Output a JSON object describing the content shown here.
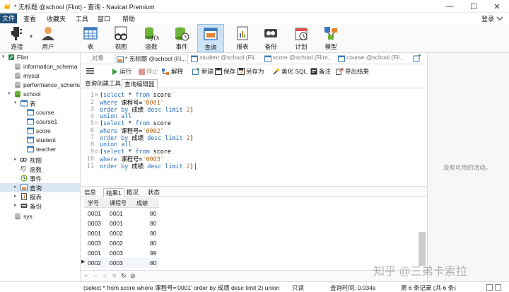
{
  "window": {
    "title": "* 无标题 @school (Flint) - 查询 - Navicat Premium",
    "login_label": "登录",
    "minimize_glyph": "—",
    "maximize_glyph": "☐",
    "close_glyph": "✕"
  },
  "menu": [
    "文件",
    "查看",
    "收藏夹",
    "工具",
    "窗口",
    "帮助"
  ],
  "toolbar": [
    {
      "label": "连接",
      "icon": "connection-icon"
    },
    {
      "label": "用户",
      "icon": "user-icon"
    },
    {
      "label": "表",
      "icon": "table-icon"
    },
    {
      "label": "视图",
      "icon": "view-icon"
    },
    {
      "label": "函数",
      "icon": "function-icon"
    },
    {
      "label": "事件",
      "icon": "event-icon"
    },
    {
      "label": "查询",
      "icon": "query-icon"
    },
    {
      "label": "报表",
      "icon": "report-icon"
    },
    {
      "label": "备份",
      "icon": "backup-icon"
    },
    {
      "label": "计划",
      "icon": "schedule-icon"
    },
    {
      "label": "模型",
      "icon": "model-icon"
    }
  ],
  "sidebar": {
    "items": [
      {
        "label": "Flint"
      },
      {
        "label": "information_schema"
      },
      {
        "label": "mysql"
      },
      {
        "label": "performance_schema"
      },
      {
        "label": "school"
      },
      {
        "label": "表"
      },
      {
        "label": "course"
      },
      {
        "label": "course1"
      },
      {
        "label": "score"
      },
      {
        "label": "student"
      },
      {
        "label": "teacher"
      },
      {
        "label": "视图"
      },
      {
        "label": "函数"
      },
      {
        "label": "事件"
      },
      {
        "label": "查询"
      },
      {
        "label": "报表"
      },
      {
        "label": "备份"
      },
      {
        "label": "sys"
      }
    ]
  },
  "tabs": [
    {
      "label": "对象"
    },
    {
      "label": "* 无标题 @school (Fl..."
    },
    {
      "label": "student @school (Fli..."
    },
    {
      "label": "score @school (Flint..."
    },
    {
      "label": "course @school (Fli..."
    }
  ],
  "query_toolbar": {
    "run": "运行",
    "stop": "停止",
    "explain": "解释",
    "new": "新建",
    "save": "保存",
    "save_as": "另存为",
    "beautify": "美化 SQL",
    "comment": "备注",
    "export": "导出结果"
  },
  "subtabs": [
    "查询创建工具",
    "查询编辑器"
  ],
  "code": [
    [
      "(select * from score"
    ],
    [
      "where 课程号='0001'"
    ],
    [
      "order by 成绩 desc limit 2)"
    ],
    [
      "union all"
    ],
    [
      "(select * from score"
    ],
    [
      "where 课程号='0002'"
    ],
    [
      "order by 成绩 desc limit 2)"
    ],
    [
      "union all"
    ],
    [
      "(select * from score"
    ],
    [
      "where 课程号='0003'"
    ],
    [
      "order by 成绩 desc limit 2)"
    ]
  ],
  "result_tabs": [
    "信息",
    "结果1",
    "概况",
    "状态"
  ],
  "grid": {
    "columns": [
      "学号",
      "课程号",
      "成绩"
    ],
    "rows": [
      [
        "0001",
        "0001",
        "80"
      ],
      [
        "0003",
        "0001",
        "80"
      ],
      [
        "0001",
        "0002",
        "90"
      ],
      [
        "0003",
        "0002",
        "80"
      ],
      [
        "0001",
        "0003",
        "99"
      ],
      [
        "0002",
        "0003",
        "80"
      ]
    ]
  },
  "right_panel": {
    "empty_text": "没有可用的活动。"
  },
  "watermark": "知乎 @三弟卡索拉",
  "status": {
    "sql": "(select * from score where 课程号='0001'  order by 成绩 desc limit 2) union",
    "readonly": "只读",
    "query_time": "查询时间: 0.034s",
    "record": "第 6 条记录 (共 6 条)"
  },
  "colors": {
    "accent": "#1f4e79",
    "active_tab": "#cfe3f7",
    "keyword": "#2b6fbb",
    "string": "#b8651a"
  }
}
